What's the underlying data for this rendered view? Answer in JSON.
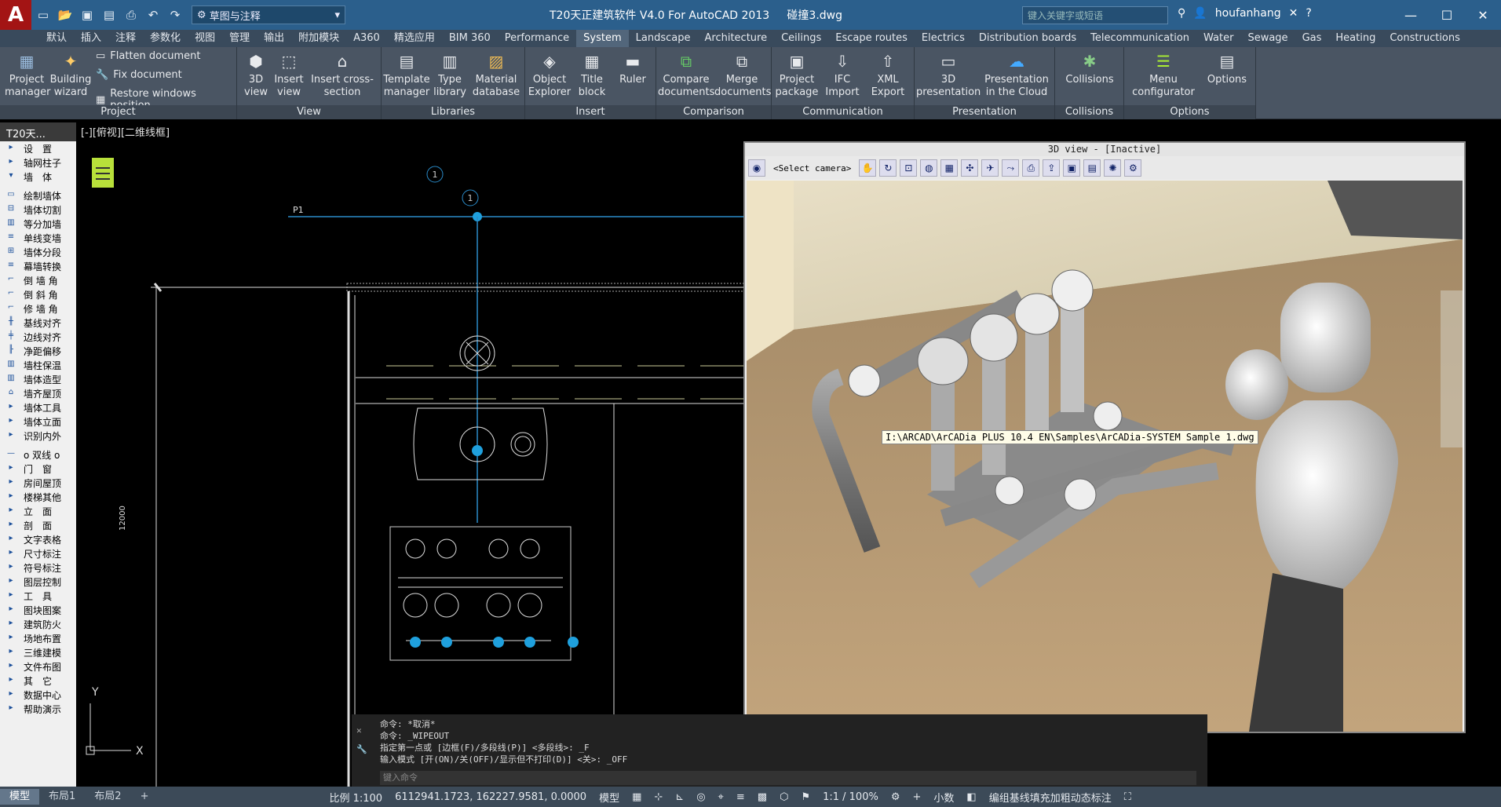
{
  "titlebar": {
    "title": "T20天正建筑软件 V4.0 For AutoCAD 2013",
    "document": "碰撞3.dwg",
    "workspace": "草图与注释",
    "search_placeholder": "键入关键字或短语",
    "user": "houfanhang"
  },
  "menu": [
    "默认",
    "插入",
    "注释",
    "参数化",
    "视图",
    "管理",
    "输出",
    "附加模块",
    "A360",
    "精选应用",
    "BIM 360",
    "Performance",
    "System",
    "Landscape",
    "Architecture",
    "Ceilings",
    "Escape routes",
    "Electrics",
    "Distribution boards",
    "Telecommunication",
    "Water",
    "Sewage",
    "Gas",
    "Heating",
    "Constructions"
  ],
  "menu_active": "System",
  "ribbon": {
    "project": {
      "label": "Project",
      "manager": "Project manager",
      "wizard": "Building wizard",
      "flatten": "Flatten document",
      "fix": "Fix document",
      "restore": "Restore windows position"
    },
    "view": {
      "label": "View",
      "b1": "3D view",
      "b2": "Insert view",
      "b3": "Insert cross-section"
    },
    "libraries": {
      "label": "Libraries",
      "b1": "Template manager",
      "b2": "Type library",
      "b3": "Material database"
    },
    "insert": {
      "label": "Insert",
      "b1": "Object Explorer",
      "b2": "Title block",
      "b3": "Ruler"
    },
    "comparison": {
      "label": "Comparison",
      "b1": "Compare documents",
      "b2": "Merge documents"
    },
    "communication": {
      "label": "Communication",
      "b1": "Project package",
      "b2": "IFC Import",
      "b3": "XML Export"
    },
    "presentation": {
      "label": "Presentation",
      "b1": "3D presentation",
      "b2": "Presentation in the Cloud"
    },
    "collisions": {
      "label": "Collisions",
      "b1": "Collisions"
    },
    "options": {
      "label": "Options",
      "b1": "Menu configurator",
      "b2": "Options"
    }
  },
  "left_panel": {
    "title": "T20天...",
    "items": [
      "设　置",
      "轴网柱子",
      "墙　体",
      "绘制墙体",
      "墙体切割",
      "等分加墙",
      "单线变墙",
      "墙体分段",
      "幕墙转换",
      "倒 墙 角",
      "倒 斜 角",
      "修 墙 角",
      "基线对齐",
      "边线对齐",
      "净距偏移",
      "墙柱保温",
      "墙体造型",
      "墙齐屋顶",
      "墙体工具",
      "墙体立面",
      "识别内外",
      "o 双线 o",
      "门　窗",
      "房间屋顶",
      "楼梯其他",
      "立　面",
      "剖　面",
      "文字表格",
      "尺寸标注",
      "符号标注",
      "图层控制",
      "工　具",
      "图块图案",
      "建筑防火",
      "场地布置",
      "三维建模",
      "文件布图",
      "其　它",
      "数据中心",
      "帮助演示"
    ]
  },
  "cad": {
    "view_label": "[-][俯视][二维线框]",
    "point_label": "P1",
    "axis_bubble": "1",
    "dim_text": "12000",
    "ucs_x": "X",
    "ucs_y": "Y"
  },
  "panel3d": {
    "title": "3D view - [Inactive]",
    "camera": "<Select camera>",
    "tooltip": "I:\\ARCAD\\ArCADia PLUS 10.4 EN\\Samples\\ArCADia-SYSTEM Sample 1.dwg"
  },
  "command": {
    "lines": [
      "命令: *取消*",
      "命令: _WIPEOUT",
      "指定第一点或 [边框(F)/多段线(P)] <多段线>: _F",
      "输入模式 [开(ON)/关(OFF)/显示但不打印(D)] <关>: _OFF"
    ],
    "placeholder": "键入命令"
  },
  "status": {
    "tabs": [
      "模型",
      "布局1",
      "布局2"
    ],
    "scale": "比例 1:100",
    "coords": "6112941.1723, 162227.9581, 0.0000",
    "model": "模型",
    "annotation_scale": "1:1 / 100%",
    "units": "小数",
    "info": "编组基线填充加粗动态标注"
  }
}
